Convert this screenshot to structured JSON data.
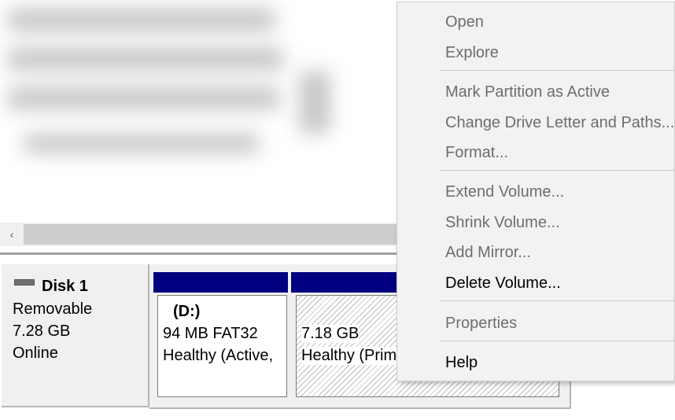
{
  "scrollbar": {
    "left_arrow": "‹"
  },
  "disk": {
    "title": "Disk 1",
    "type": "Removable",
    "size": "7.28 GB",
    "status": "Online"
  },
  "partitions": [
    {
      "label": "(D:)",
      "size": "94 MB FAT32",
      "status": "Healthy (Active,"
    },
    {
      "label": "",
      "size": "7.18 GB",
      "status": "Healthy (Prim"
    }
  ],
  "context_menu": {
    "items": [
      {
        "label": "Open",
        "enabled": false
      },
      {
        "label": "Explore",
        "enabled": false
      },
      {
        "label": "Mark Partition as Active",
        "enabled": false
      },
      {
        "label": "Change Drive Letter and Paths...",
        "enabled": false
      },
      {
        "label": "Format...",
        "enabled": false
      },
      {
        "label": "Extend Volume...",
        "enabled": false
      },
      {
        "label": "Shrink Volume...",
        "enabled": false
      },
      {
        "label": "Add Mirror...",
        "enabled": false
      },
      {
        "label": "Delete Volume...",
        "enabled": true
      },
      {
        "label": "Properties",
        "enabled": false
      },
      {
        "label": "Help",
        "enabled": true
      }
    ]
  },
  "colors": {
    "partition_header": "#000080",
    "menu_bg": "#f2f2f2",
    "disabled_text": "#6d6d6d"
  }
}
